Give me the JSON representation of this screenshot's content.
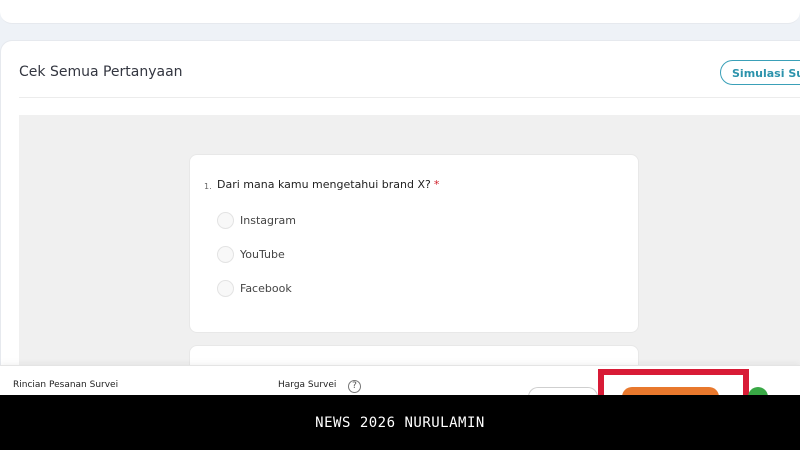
{
  "section": {
    "title": "Cek Semua Pertanyaan",
    "simulate_button": "Simulasi Survei"
  },
  "question": {
    "number": "1.",
    "text": "Dari mana kamu mengetahui brand X?",
    "required_mark": "*",
    "options": [
      {
        "label": "Instagram"
      },
      {
        "label": "YouTube"
      },
      {
        "label": "Facebook"
      }
    ]
  },
  "footer": {
    "summary_label": "Rincian Pesanan Survei",
    "price_label": "Harga Survei",
    "help_glyph": "?"
  },
  "watermark": {
    "text": "NEWS 2026 NURULAMIN"
  },
  "colors": {
    "primary_button": "#e8782d",
    "highlight_frame": "#d81b36",
    "accent_teal": "#2c93ac",
    "required": "#d0202b"
  }
}
